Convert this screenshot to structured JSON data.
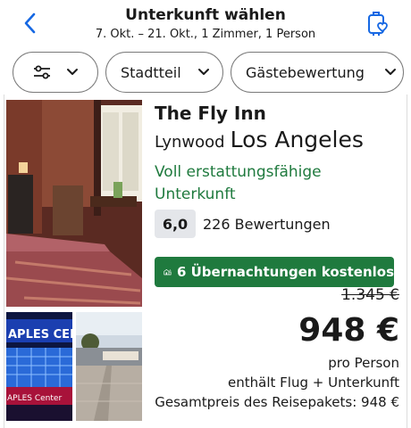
{
  "header": {
    "title": "Unterkunft wählen",
    "subtitle": "7. Okt. – 21. Okt., 1 Zimmer, 1 Person",
    "back_icon": "chevron-left-icon",
    "wishlist_icon": "luggage-heart-icon"
  },
  "filters": {
    "filter_icon": "sliders-icon",
    "district_label": "Stadtteil",
    "rating_label": "Gästebewertung"
  },
  "hotel": {
    "name": "The Fly Inn",
    "district": "Lynwood",
    "city": "Los Angeles",
    "refund": "Voll erstattungsfähige Unterkunft",
    "rating": "6,0",
    "reviews": "226 Bewertungen",
    "promo": "6 Übernachtungen kostenlos",
    "old_price": "1.345 €",
    "price": "948 €",
    "per_person": "pro Person",
    "includes": "enthält Flug + Unterkunft",
    "total": "Gesamtpreis des Reisepakets: 948 €",
    "photo_a_sign": "APLES CEN",
    "photo_a_sign2": "APLES Center"
  },
  "colors": {
    "accent_blue": "#1668e3",
    "refund_green": "#1f7a3e",
    "promo_green": "#1f7a3e",
    "badge_gray": "#e4e6ea"
  }
}
